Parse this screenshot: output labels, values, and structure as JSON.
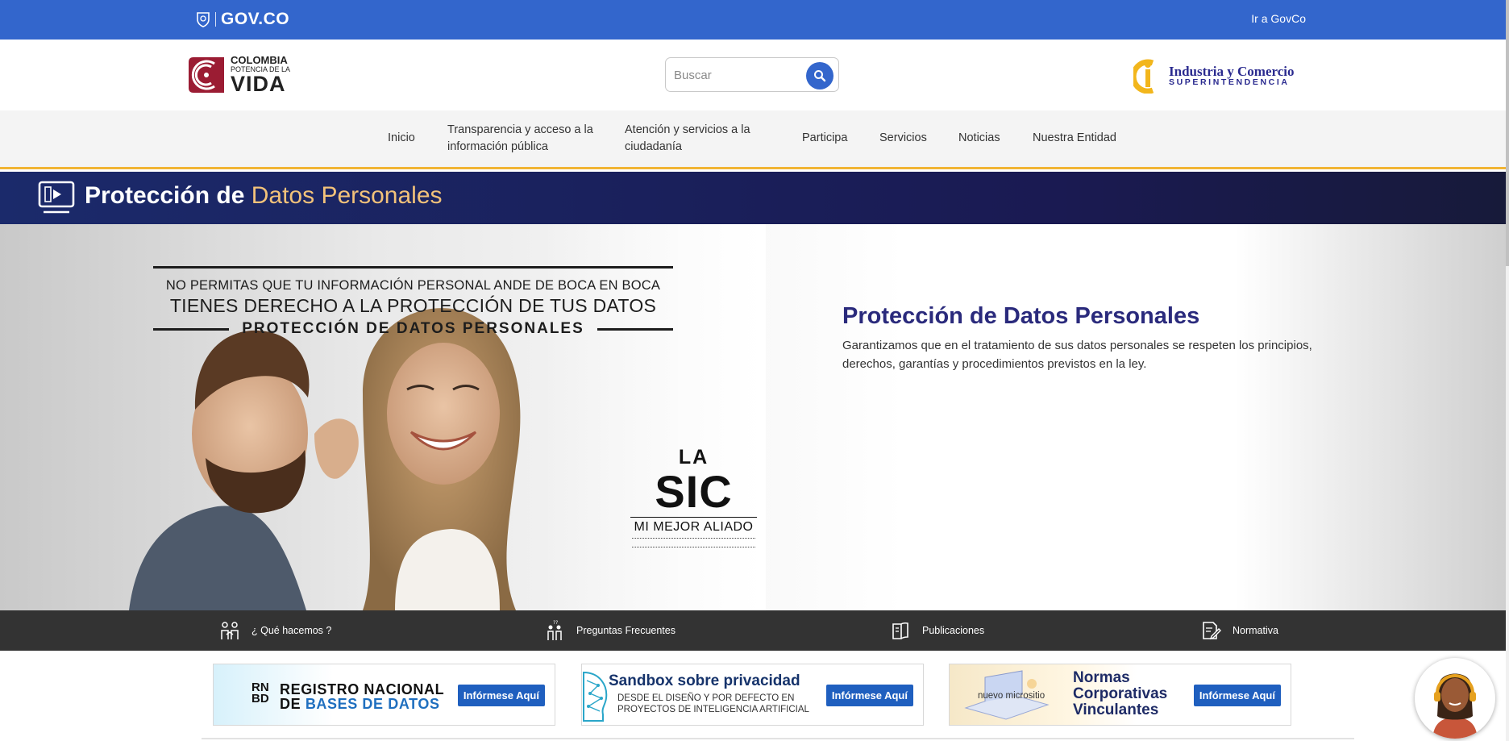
{
  "gov_bar": {
    "logo_text": "GOV.CO",
    "link": "Ir a GovCo",
    "color": "#3366cc"
  },
  "header": {
    "colombia_logo": {
      "line1": "COLOMBIA",
      "line2": "POTENCIA DE LA",
      "line3": "VIDA"
    },
    "search": {
      "placeholder": "Buscar",
      "icon": "search-icon"
    },
    "sic_logo": {
      "line1": "Industria y Comercio",
      "line2": "SUPERINTENDENCIA"
    }
  },
  "nav": {
    "items": [
      {
        "label": "Inicio"
      },
      {
        "label": "Transparencia y acceso a la información pública"
      },
      {
        "label": "Atención y servicios a la ciudadanía"
      },
      {
        "label": "Participa"
      },
      {
        "label": "Servicios"
      },
      {
        "label": "Noticias"
      },
      {
        "label": "Nuestra Entidad"
      }
    ],
    "accent_color": "#f1b434"
  },
  "section_band": {
    "title_bold": "Protección de",
    "title_accent": "Datos Personales",
    "icon": "presentation-icon"
  },
  "hero": {
    "banner": {
      "line1": "NO PERMITAS QUE TU INFORMACIÓN PERSONAL ANDE DE BOCA EN BOCA",
      "line2": "TIENES DERECHO A LA PROTECCIÓN DE TUS DATOS",
      "line3": "PROTECCIÓN DE DATOS PERSONALES"
    },
    "stamp": {
      "la": "LA",
      "sic": "SIC",
      "tagline": "MI MEJOR ALIADO"
    },
    "heading": "Protección de Datos Personales",
    "description": "Garantizamos que en el tratamiento de sus datos personales se respeten los principios, derechos, garantías y procedimientos previstos en la  ley."
  },
  "quick_links": [
    {
      "label": "¿ Qué hacemos ?",
      "icon": "team-icon"
    },
    {
      "label": "Preguntas Frecuentes",
      "icon": "people-question-icon"
    },
    {
      "label": "Publicaciones",
      "icon": "book-icon"
    },
    {
      "label": "Normativa",
      "icon": "document-edit-icon"
    }
  ],
  "cards": [
    {
      "badge_top": "RN",
      "badge_bottom": "BD",
      "title_top": "REGISTRO NACIONAL",
      "title_bottom_prefix": "DE ",
      "title_bottom_blue": "BASES DE DATOS",
      "button": "Infórmese Aquí"
    },
    {
      "title": "Sandbox sobre privacidad",
      "subtitle_line1": "DESDE EL DISEÑO Y POR DEFECTO EN",
      "subtitle_line2": "PROYECTOS DE INTELIGENCIA ARTIFICIAL",
      "button": "Infórmese Aquí"
    },
    {
      "sub": "nuevo micrositio",
      "title_line1": "Normas",
      "title_line2": "Corporativas",
      "title_line3": "Vinculantes",
      "button": "Infórmese Aquí"
    }
  ]
}
